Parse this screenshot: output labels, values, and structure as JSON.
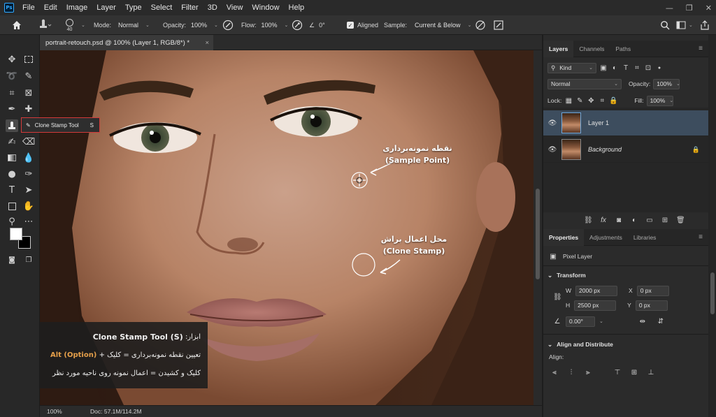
{
  "menubar": {
    "logo": "Ps",
    "items": [
      "File",
      "Edit",
      "Image",
      "Layer",
      "Type",
      "Select",
      "Filter",
      "3D",
      "View",
      "Window",
      "Help"
    ],
    "controls": [
      "—",
      "❐",
      "✕"
    ]
  },
  "options_bar": {
    "brush_size": "40",
    "mode_label": "Mode:",
    "mode_value": "Normal",
    "opacity_label": "Opacity:",
    "opacity_value": "100%",
    "flow_label": "Flow:",
    "flow_value": "100%",
    "angle_value": "0°",
    "aligned_label": "Aligned",
    "aligned_checked": true,
    "sample_label": "Sample:",
    "sample_value": "Current & Below"
  },
  "tooltip": {
    "label": "Clone Stamp Tool",
    "shortcut": "S"
  },
  "document": {
    "tab_title": "portrait-retouch.psd @ 100% (Layer 1, RGB/8*) *",
    "close": "×"
  },
  "status": {
    "zoom": "100%",
    "doc_info": "Doc: 57.1M/114.2M"
  },
  "annotations": {
    "sample_point_fa": "نقطه نمونه‌برداری",
    "sample_point_en": "(Sample Point)",
    "clone_area_fa": "محل اعمال براش",
    "clone_area_en": "(Clone Stamp)"
  },
  "info_box": {
    "title_prefix": "ابزار:",
    "title_tool": "Clone Stamp Tool (S)",
    "line1_text": "تعیین نقطه نمونه‌برداری = کلیک +",
    "line1_key": "Alt (Option)",
    "line2_text": "کلیک و کشیدن = اعمال نمونه روی ناحیه مورد نظر"
  },
  "layers_panel": {
    "tabs": [
      "Layers",
      "Channels",
      "Paths"
    ],
    "active_tab": "Layers",
    "filter_kind": "Kind",
    "blend_mode": "Normal",
    "opacity_label": "Opacity:",
    "opacity_value": "100%",
    "lock_label": "Lock:",
    "fill_label": "Fill:",
    "fill_value": "100%",
    "layers": [
      {
        "name": "Layer 1",
        "selected": true,
        "locked": false
      },
      {
        "name": "Background",
        "selected": false,
        "locked": true
      }
    ]
  },
  "properties_panel": {
    "tabs": [
      "Properties",
      "Adjustments",
      "Libraries"
    ],
    "active_tab": "Properties",
    "type_label": "Pixel Layer",
    "transform_header": "Transform",
    "w_label": "W",
    "w_value": "2000 px",
    "h_label": "H",
    "h_value": "2500 px",
    "x_label": "X",
    "x_value": "0 px",
    "y_label": "Y",
    "y_value": "0 px",
    "angle_value": "0.00°",
    "align_header": "Align and Distribute",
    "align_label": "Align:"
  },
  "colors": {
    "accent_selection": "#3d4d5e",
    "tooltip_border": "#d43a3a",
    "highlight_text": "#e6a04a"
  }
}
